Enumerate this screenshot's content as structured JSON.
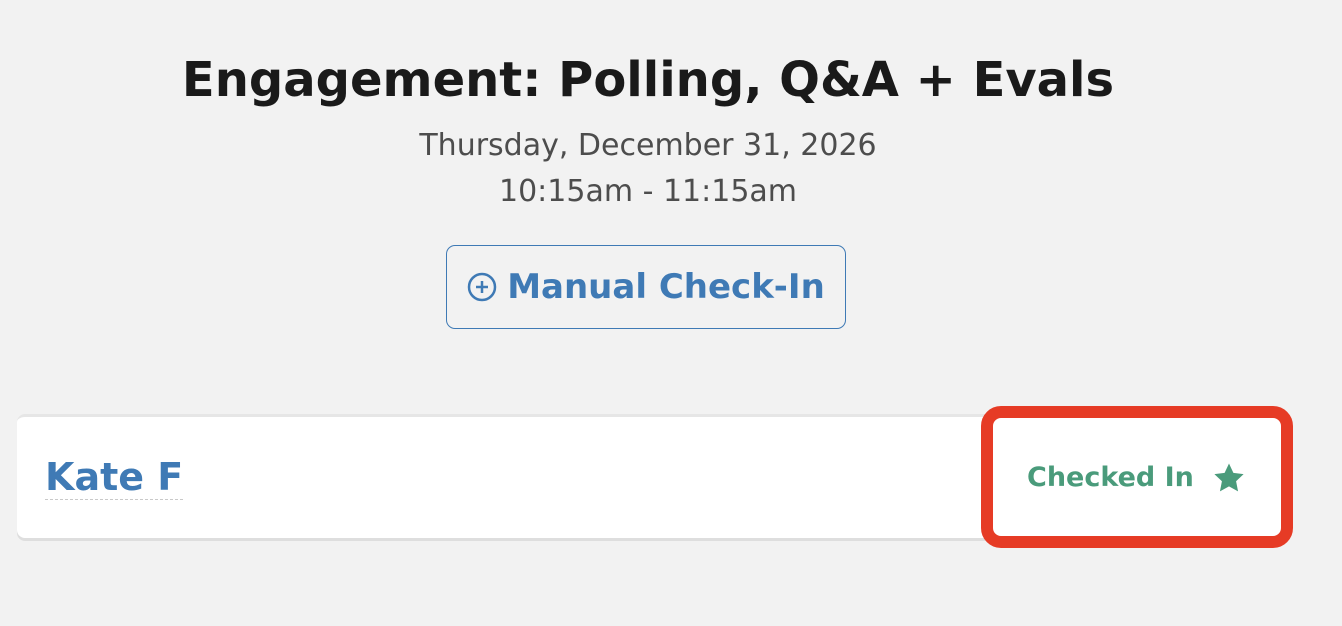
{
  "session": {
    "title": "Engagement: Polling, Q&A + Evals",
    "date": "Thursday, December 31, 2026",
    "time": "10:15am - 11:15am"
  },
  "actions": {
    "manual_checkin_label": "Manual Check-In",
    "manual_checkin_icon": "plus-circle-icon"
  },
  "attendees": [
    {
      "name": "Kate F",
      "status": "Checked In",
      "status_icon": "star-icon"
    }
  ],
  "colors": {
    "background": "#f2f2f2",
    "link_blue": "#3f7ab5",
    "status_green": "#4a9b7b",
    "highlight_red": "#e63b25"
  }
}
